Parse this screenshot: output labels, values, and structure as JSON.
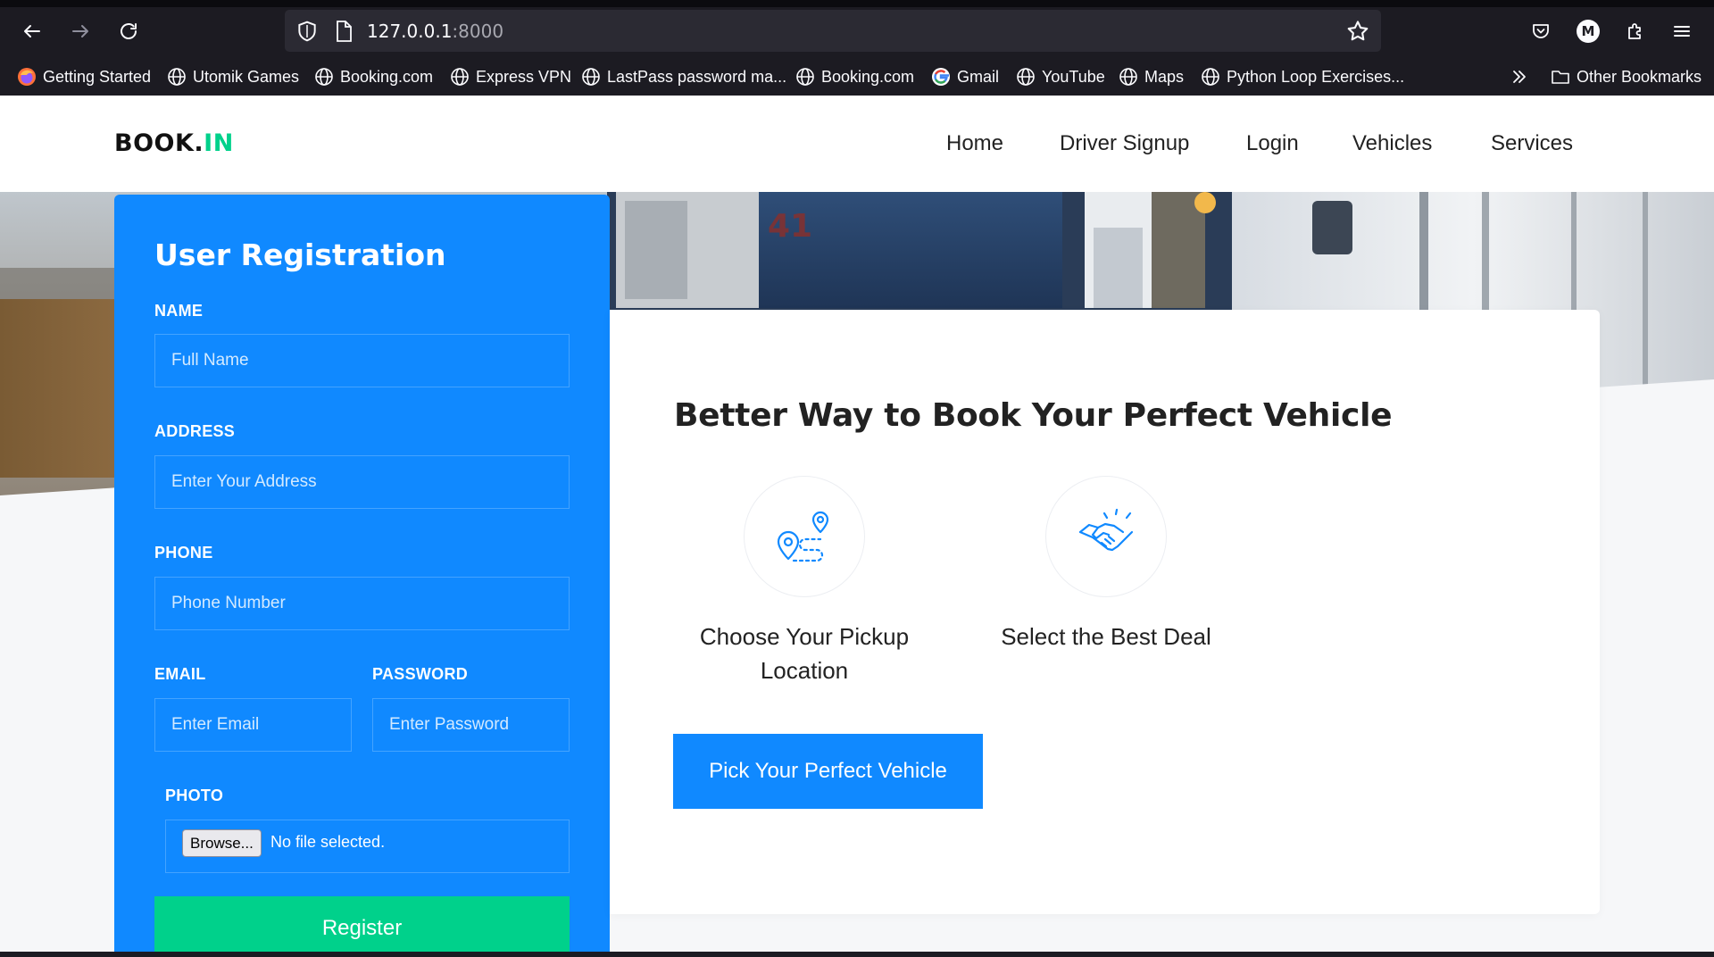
{
  "browser": {
    "url_host": "127.0.0.1",
    "url_port": ":8000",
    "profile_initial": "M",
    "bookmarks": [
      {
        "label": "Getting Started",
        "icon": "firefox-icon"
      },
      {
        "label": "Utomik Games",
        "icon": "globe-icon"
      },
      {
        "label": "Booking.com",
        "icon": "globe-icon"
      },
      {
        "label": "Express VPN",
        "icon": "globe-icon"
      },
      {
        "label": "LastPass password ma...",
        "icon": "globe-icon"
      },
      {
        "label": "Booking.com",
        "icon": "globe-icon"
      },
      {
        "label": "Gmail",
        "icon": "google-icon"
      },
      {
        "label": "YouTube",
        "icon": "globe-icon"
      },
      {
        "label": "Maps",
        "icon": "globe-icon"
      },
      {
        "label": "Python Loop Exercises...",
        "icon": "globe-icon"
      }
    ],
    "other_bookmarks": "Other Bookmarks"
  },
  "site": {
    "logo_main": "BOOK.",
    "logo_accent": "IN",
    "nav": [
      "Home",
      "Driver Signup",
      "Login",
      "Vehicles",
      "Services"
    ],
    "colors": {
      "primary": "#1089ff",
      "accent": "#00d18b"
    }
  },
  "registration": {
    "title": "User Registration",
    "name_label": "NAME",
    "name_placeholder": "Full Name",
    "address_label": "ADDRESS",
    "address_placeholder": "Enter Your Address",
    "phone_label": "PHONE",
    "phone_placeholder": "Phone Number",
    "email_label": "EMAIL",
    "email_placeholder": "Enter Email",
    "password_label": "PASSWORD",
    "password_placeholder": "Enter Password",
    "photo_label": "PHOTO",
    "browse_label": "Browse...",
    "file_status": "No file selected.",
    "submit_label": "Register"
  },
  "content": {
    "headline": "Better Way to Book Your Perfect Vehicle",
    "features": [
      {
        "icon": "map-route-icon",
        "line1": "Choose Your Pickup",
        "line2": "Location"
      },
      {
        "icon": "handshake-icon",
        "line1": "Select the Best Deal",
        "line2": ""
      }
    ],
    "cta_label": "Pick Your Perfect Vehicle"
  }
}
